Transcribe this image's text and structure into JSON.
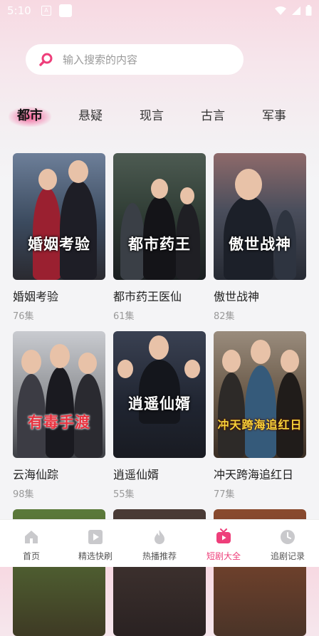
{
  "status_bar": {
    "time": "5:10",
    "icon_a": "A"
  },
  "search": {
    "placeholder": "输入搜索的内容"
  },
  "tabs": [
    {
      "label": "都市",
      "active": true
    },
    {
      "label": "悬疑",
      "active": false
    },
    {
      "label": "现言",
      "active": false
    },
    {
      "label": "古言",
      "active": false
    },
    {
      "label": "军事",
      "active": false
    }
  ],
  "dramas": [
    {
      "title": "婚姻考验",
      "episodes": "76集",
      "poster_text": "婚姻考验",
      "color": "#3b4a5e"
    },
    {
      "title": "都市药王医仙",
      "episodes": "61集",
      "poster_text": "都市药王",
      "color": "#2f3c34"
    },
    {
      "title": "傲世战神",
      "episodes": "82集",
      "poster_text": "傲世战神",
      "color": "#2b3340"
    },
    {
      "title": "云海仙踪",
      "episodes": "98集",
      "poster_text": "有毒手渡",
      "color": "#8d8f93"
    },
    {
      "title": "逍遥仙婿",
      "episodes": "55集",
      "poster_text": "逍遥仙婿",
      "color": "#1f2430"
    },
    {
      "title": "冲天跨海追红日",
      "episodes": "77集",
      "poster_text": "冲天跨海追红日",
      "color": "#6a5a49"
    }
  ],
  "bottom_nav": [
    {
      "label": "首页",
      "icon": "home-icon",
      "active": false
    },
    {
      "label": "精选快刷",
      "icon": "play-square-icon",
      "active": false
    },
    {
      "label": "热播推荐",
      "icon": "flame-icon",
      "active": false
    },
    {
      "label": "短剧大全",
      "icon": "tv-icon",
      "active": true
    },
    {
      "label": "追剧记录",
      "icon": "clock-icon",
      "active": false
    }
  ],
  "colors": {
    "accent": "#ee3e7a",
    "background": "#f4f4f6"
  }
}
